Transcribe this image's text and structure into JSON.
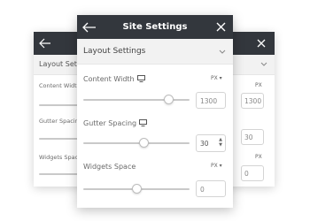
{
  "left_panel": {
    "section_title": "Layout Setti",
    "content_width_label": "Content Widt",
    "gutter_label": "Gutter Spacin",
    "widgets_label": "Widgets Spac"
  },
  "right_panel": {
    "unit_1": "PX",
    "value_1": "1300",
    "value_2": "30",
    "unit_3": "PX",
    "value_3": "0"
  },
  "main_panel": {
    "title": "Site Settings",
    "section_title": "Layout Settings",
    "controls": [
      {
        "label": "Content Width",
        "unit": "PX",
        "value": "1300",
        "slider_level": 0.85
      },
      {
        "label": "Gutter Spacing",
        "unit": "",
        "value": "30",
        "slider_level": 0.52
      },
      {
        "label": "Widgets Space",
        "unit": "PX",
        "value": "0",
        "slider_level": 0.42
      }
    ]
  },
  "colors": {
    "header_bg": "#33373d",
    "section_bg": "#f2f2f2"
  },
  "icons": [
    "arrow-left-icon",
    "close-icon",
    "chevron-down-icon",
    "monitor-icon",
    "spinner-arrows-icon"
  ]
}
